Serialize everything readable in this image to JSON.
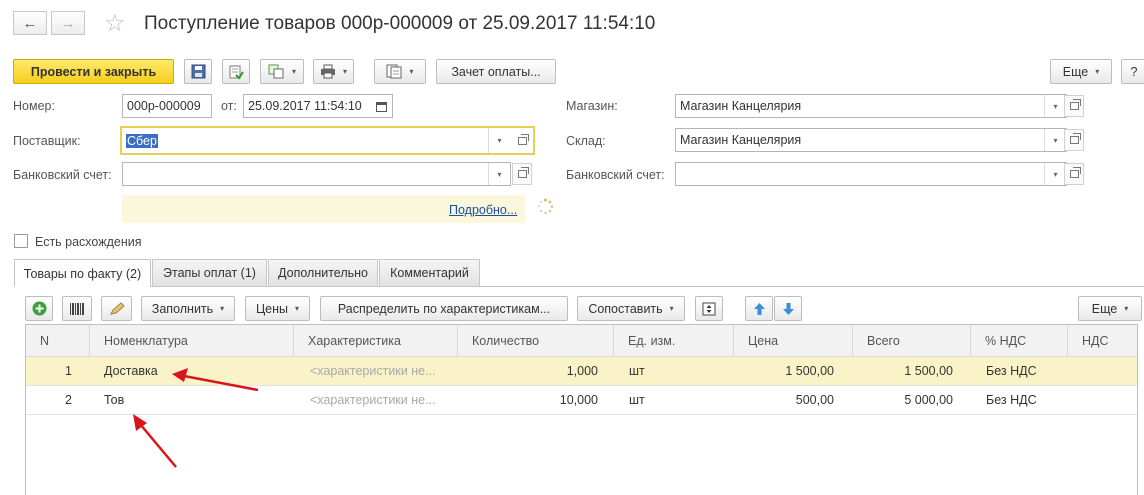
{
  "window": {
    "title": "Поступление товаров 000р-000009 от 25.09.2017 11:54:10",
    "back_glyph": "←",
    "forward_glyph": "→",
    "star_glyph": "☆"
  },
  "toolbar": {
    "post_close_label": "Провести и закрыть",
    "payment_offset_label": "Зачет оплаты...",
    "more_label": "Еще",
    "help_label": "?"
  },
  "header": {
    "number_label": "Номер:",
    "number_value": "000р-000009",
    "from_label": "от:",
    "date_value": "25.09.2017 11:54:10",
    "supplier_label": "Поставщик:",
    "supplier_value": "Сбер",
    "bank_label": "Банковский счет:",
    "bank_value": "",
    "shop_label": "Магазин:",
    "shop_value": "Магазин Канцелярия",
    "warehouse_label": "Склад:",
    "warehouse_value": "Магазин Канцелярия",
    "bank2_label": "Банковский счет:",
    "bank2_value": "",
    "details_link": "Подробно...",
    "discrepancy_label": "Есть расхождения",
    "discrepancy_checked": false
  },
  "tabs": [
    {
      "label": "Товары по факту (2)",
      "active": true
    },
    {
      "label": "Этапы оплат (1)",
      "active": false
    },
    {
      "label": "Дополнительно",
      "active": false
    },
    {
      "label": "Комментарий",
      "active": false
    }
  ],
  "table_toolbar": {
    "fill_label": "Заполнить",
    "prices_label": "Цены",
    "distribute_label": "Распределить по характеристикам...",
    "compare_label": "Сопоставить",
    "more_label": "Еще"
  },
  "table": {
    "columns": [
      "N",
      "Номенклатура",
      "Характеристика",
      "Количество",
      "Ед. изм.",
      "Цена",
      "Всего",
      "% НДС",
      "НДС"
    ],
    "rows": [
      {
        "n": "1",
        "item": "Доставка",
        "characteristic": "<характеристики не...",
        "qty": "1,000",
        "unit": "шт",
        "price": "1 500,00",
        "total": "1 500,00",
        "vat_rate": "Без НДС",
        "vat": "",
        "selected": true
      },
      {
        "n": "2",
        "item": "Тов",
        "characteristic": "<характеристики не...",
        "qty": "10,000",
        "unit": "шт",
        "price": "500,00",
        "total": "5 000,00",
        "vat_rate": "Без НДС",
        "vat": "",
        "selected": false
      }
    ]
  },
  "colors": {
    "accent_yellow": "#f5cf1c",
    "selected_row": "#fbf3c8",
    "annotation_arrow": "#d9141b",
    "link_blue": "#1a4fa3"
  }
}
